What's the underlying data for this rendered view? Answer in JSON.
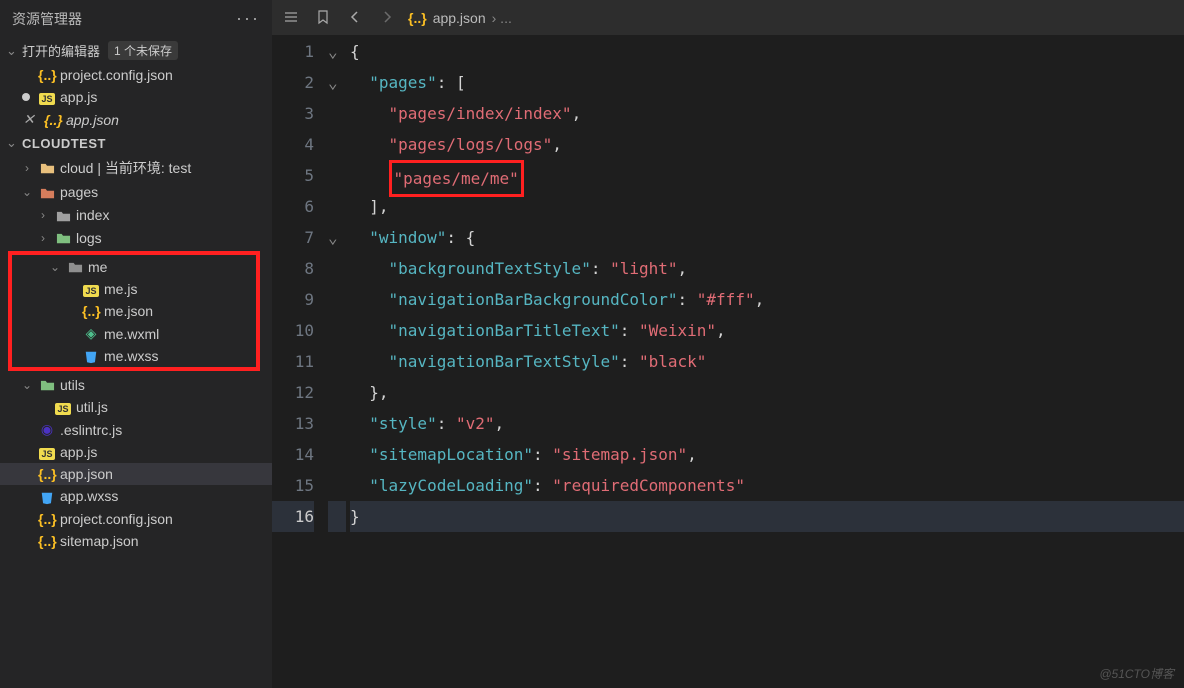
{
  "sidebar": {
    "title": "资源管理器",
    "openEditors": {
      "label": "打开的编辑器",
      "unsavedBadge": "1 个未保存",
      "items": [
        {
          "name": "project.config.json",
          "icon": "json",
          "modified": false
        },
        {
          "name": "app.js",
          "icon": "js",
          "modified": true
        },
        {
          "name": "app.json",
          "icon": "json",
          "modified": false,
          "italic": true,
          "closeable": true
        }
      ]
    },
    "project": {
      "name": "CLOUDTEST",
      "tree": [
        {
          "depth": 1,
          "name": "cloud | 当前环境: test",
          "type": "folder-yellow",
          "expanded": false,
          "chev": "›"
        },
        {
          "depth": 1,
          "name": "pages",
          "type": "folder-red",
          "expanded": true,
          "chev": "⌄"
        },
        {
          "depth": 2,
          "name": "index",
          "type": "folder-gray",
          "expanded": false,
          "chev": "›"
        },
        {
          "depth": 2,
          "name": "logs",
          "type": "folder-green",
          "expanded": false,
          "chev": "›"
        },
        {
          "depth": 2,
          "name": "me",
          "type": "folder-open-gray",
          "expanded": true,
          "chev": "⌄",
          "hlStart": true
        },
        {
          "depth": 3,
          "name": "me.js",
          "type": "js"
        },
        {
          "depth": 3,
          "name": "me.json",
          "type": "json"
        },
        {
          "depth": 3,
          "name": "me.wxml",
          "type": "wxml"
        },
        {
          "depth": 3,
          "name": "me.wxss",
          "type": "wxss",
          "hlEnd": true
        },
        {
          "depth": 1,
          "name": "utils",
          "type": "folder-green",
          "expanded": true,
          "chev": "⌄"
        },
        {
          "depth": 2,
          "name": "util.js",
          "type": "js"
        },
        {
          "depth": 1,
          "name": ".eslintrc.js",
          "type": "eslint"
        },
        {
          "depth": 1,
          "name": "app.js",
          "type": "js"
        },
        {
          "depth": 1,
          "name": "app.json",
          "type": "json",
          "selected": true
        },
        {
          "depth": 1,
          "name": "app.wxss",
          "type": "wxss"
        },
        {
          "depth": 1,
          "name": "project.config.json",
          "type": "json"
        },
        {
          "depth": 1,
          "name": "sitemap.json",
          "type": "json"
        }
      ]
    }
  },
  "editor": {
    "breadcrumb": {
      "file": "app.json",
      "rest": "›  ..."
    },
    "lines": [
      {
        "n": 1,
        "fold": "⌄",
        "html": "<span class='tok-punc'>{</span>"
      },
      {
        "n": 2,
        "fold": "⌄",
        "html": "  <span class='tok-key'>\"pages\"</span><span class='tok-punc'>: [</span>"
      },
      {
        "n": 3,
        "html": "    <span class='tok-str'>\"pages/index/index\"</span><span class='tok-punc'>,</span>"
      },
      {
        "n": 4,
        "html": "    <span class='tok-str'>\"pages/logs/logs\"</span><span class='tok-punc'>,</span>"
      },
      {
        "n": 5,
        "html": "    <span class='hl-code'><span class='tok-str'>\"pages/me/me\"</span></span>"
      },
      {
        "n": 6,
        "html": "  <span class='tok-punc'>],</span>"
      },
      {
        "n": 7,
        "fold": "⌄",
        "html": "  <span class='tok-key'>\"window\"</span><span class='tok-punc'>: {</span>"
      },
      {
        "n": 8,
        "html": "    <span class='tok-key'>\"backgroundTextStyle\"</span><span class='tok-punc'>: </span><span class='tok-str'>\"light\"</span><span class='tok-punc'>,</span>"
      },
      {
        "n": 9,
        "html": "    <span class='tok-key'>\"navigationBarBackgroundColor\"</span><span class='tok-punc'>: </span><span class='tok-str'>\"#fff\"</span><span class='tok-punc'>,</span>"
      },
      {
        "n": 10,
        "html": "    <span class='tok-key'>\"navigationBarTitleText\"</span><span class='tok-punc'>: </span><span class='tok-str'>\"Weixin\"</span><span class='tok-punc'>,</span>"
      },
      {
        "n": 11,
        "html": "    <span class='tok-key'>\"navigationBarTextStyle\"</span><span class='tok-punc'>: </span><span class='tok-str'>\"black\"</span>"
      },
      {
        "n": 12,
        "html": "  <span class='tok-punc'>},</span>"
      },
      {
        "n": 13,
        "html": "  <span class='tok-key'>\"style\"</span><span class='tok-punc'>: </span><span class='tok-str'>\"v2\"</span><span class='tok-punc'>,</span>"
      },
      {
        "n": 14,
        "html": "  <span class='tok-key'>\"sitemapLocation\"</span><span class='tok-punc'>: </span><span class='tok-str'>\"sitemap.json\"</span><span class='tok-punc'>,</span>"
      },
      {
        "n": 15,
        "html": "  <span class='tok-key'>\"lazyCodeLoading\"</span><span class='tok-punc'>: </span><span class='tok-str'>\"requiredComponents\"</span>"
      },
      {
        "n": 16,
        "cur": true,
        "html": "<span class='tok-punc'>}</span>"
      }
    ]
  },
  "watermark": "@51CTO博客"
}
